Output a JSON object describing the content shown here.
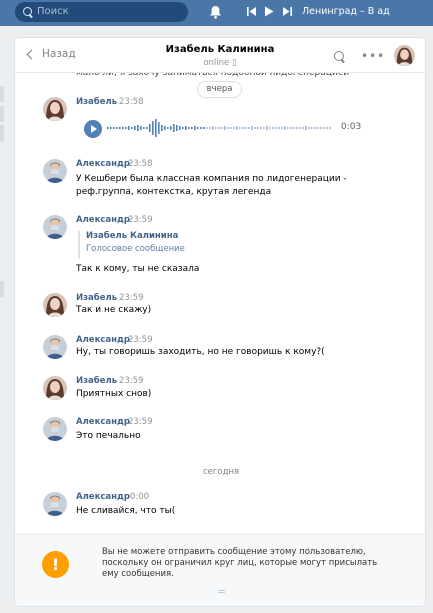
{
  "topbar": {
    "search_placeholder": "Поиск",
    "now_playing": "Ленинград – В ад"
  },
  "header": {
    "back_label": "Назад",
    "title": "Изабель Калинина",
    "status": "online ▯"
  },
  "chat": {
    "cut_line": "мало ли, я захочу заниматься подобной лидогенерацией",
    "date_top": "вчера",
    "date_bottom": "сегодня",
    "voice_duration": "0:03",
    "messages": [
      {
        "name": "Изабель",
        "time": "23:58",
        "text": ""
      },
      {
        "name": "Александр",
        "time": "23:58",
        "text": "У Кешбери была классная компания по лидогенерации -",
        "text2": "реф.группа, контекстка, крутая легенда"
      },
      {
        "name": "Александр",
        "time": "23:59",
        "text": "Так к кому, ты не сказала"
      },
      {
        "name": "Изабель",
        "time": "23:59",
        "text": "Так и не скажу)"
      },
      {
        "name": "Александр",
        "time": "23:59",
        "text": "Ну, ты говоришь заходить, но не говоришь к кому?("
      },
      {
        "name": "Изабель",
        "time": "23:59",
        "text": "Приятных снов)"
      },
      {
        "name": "Александр",
        "time": "23:59",
        "text": "Это печально"
      },
      {
        "name": "Александр",
        "time": "0:00",
        "text": "Не сливайся, что ты("
      }
    ],
    "forwarded": {
      "name": "Изабель Калинина",
      "text": "Голосовое сообщение"
    }
  },
  "notice": {
    "icon": "!",
    "text": "Вы не можете отправить сообщение этому пользователю, поскольку он ограничил круг лиц, которые могут присылать ему сообщения."
  },
  "colors": {
    "topbar": "#4a76a8",
    "name": "#42648b",
    "play": "#5181b8",
    "warning": "#ffa000"
  }
}
